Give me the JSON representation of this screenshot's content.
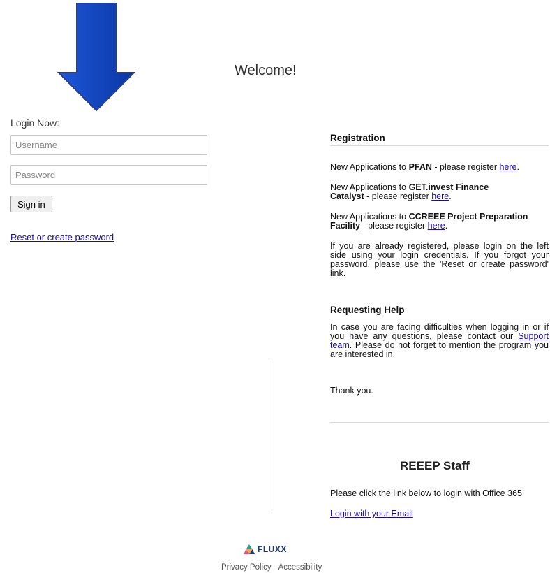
{
  "page": {
    "welcome": "Welcome!"
  },
  "login": {
    "label": "Login Now:",
    "username_placeholder": "Username",
    "password_placeholder": "Password",
    "signin_label": "Sign in",
    "reset_link": "Reset or create password"
  },
  "registration": {
    "title": "Registration",
    "pfan": {
      "pre": "New Applications to ",
      "bold": "PFAN",
      "post": " - please register ",
      "link": "here",
      "end": "."
    },
    "getinvest": {
      "pre": "New Applications to ",
      "bold": "GET.invest Finance Catalyst",
      "post": " - please register ",
      "link": "here",
      "end": "."
    },
    "ccreee": {
      "pre": "New Applications to ",
      "bold": "CCREEE Project Preparation Facility",
      "post": " - please register ",
      "link": "here",
      "end": "."
    },
    "already": "If you are already registered, please login on the left side using your login credentials. If you forgot your password, please use the 'Reset or create password' link."
  },
  "help": {
    "title": "Requesting Help",
    "text_pre": "In case you are facing difficulties when logging in or if you have any questions, please contact our ",
    "support_link": "Support team",
    "text_post": ". Please do not forget to mention the program you are interested in.",
    "thanks": "Thank you."
  },
  "staff": {
    "title": "REEEP Staff",
    "text": "Please click the link below to login with Office 365",
    "email_link": "Login with your Email"
  },
  "footer": {
    "brand": "FLUXX",
    "privacy": "Privacy Policy",
    "accessibility": "Accessibility"
  },
  "colors": {
    "arrow": "#0b3fb3",
    "link": "#1a0dab"
  }
}
